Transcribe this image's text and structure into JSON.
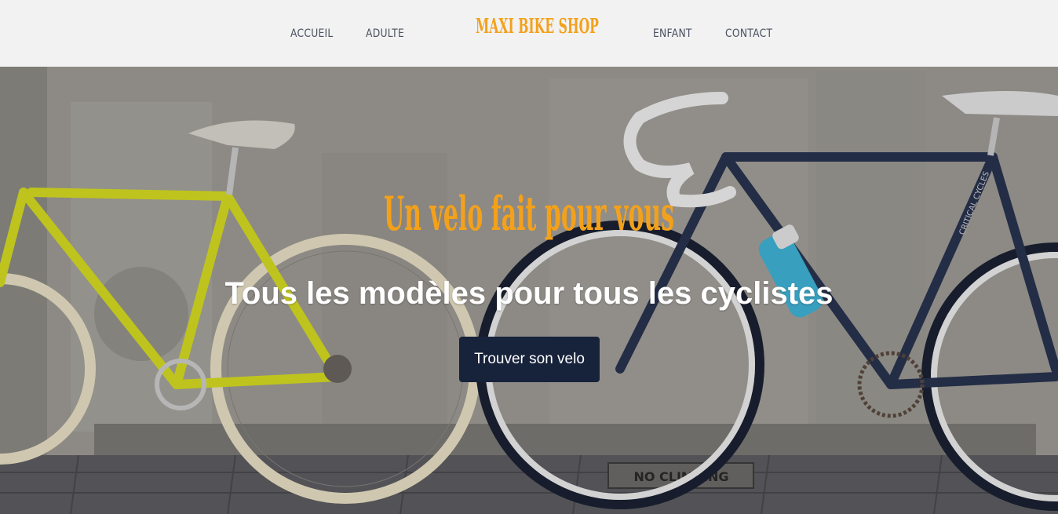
{
  "header": {
    "logo_text": "MAXI BIKE SHOP",
    "nav": {
      "accueil": "ACCUEIL",
      "adulte": "ADULTE",
      "enfant": "ENFANT",
      "contact": "CONTACT"
    }
  },
  "hero": {
    "title": "Un velo fait pour vous",
    "subtitle": "Tous les modèles pour tous les cyclistes",
    "cta_label": "Trouver son velo",
    "sign_text": "NO CLIMBING",
    "frame_text": "CRITICAL CYCLES"
  },
  "colors": {
    "accent": "#f3a11b",
    "button": "#17223b",
    "header_bg": "#f6f6f7",
    "nav_text": "#4a5160"
  },
  "icons": [
    "yellow-bicycle",
    "navy-bicycle",
    "water-bottle"
  ]
}
